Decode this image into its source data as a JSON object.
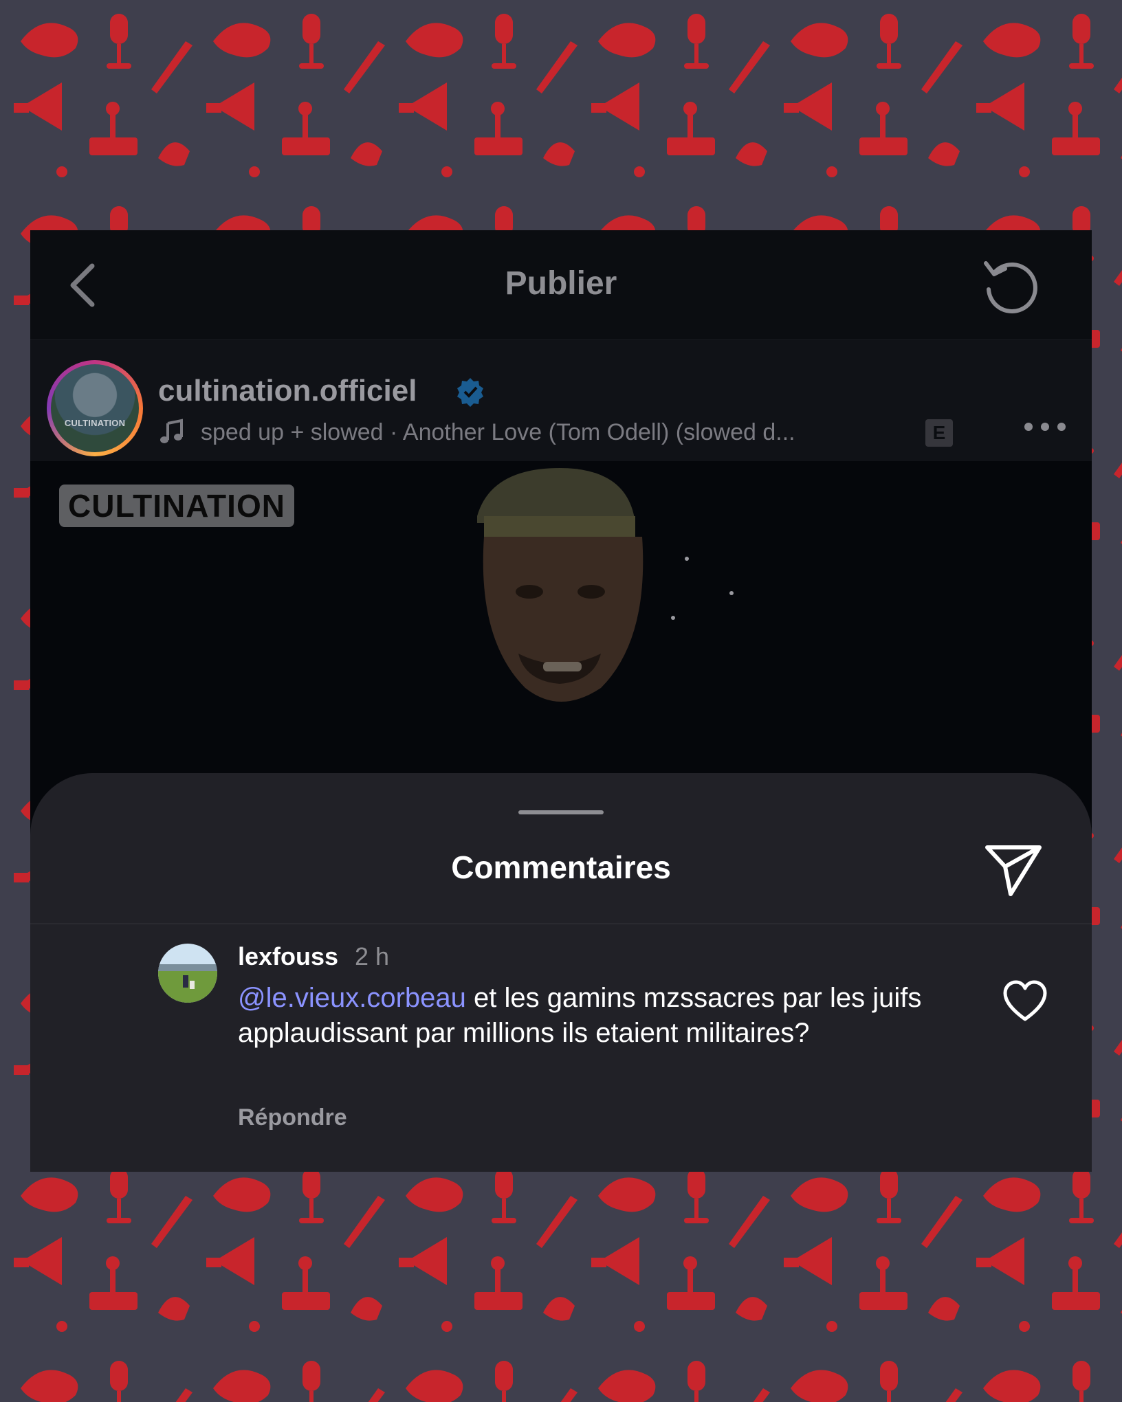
{
  "header": {
    "title": "Publier"
  },
  "post": {
    "username": "cultination.officiel",
    "avatar_label": "CULTINATION",
    "music": "sped up + slowed · Another Love (Tom Odell) (slowed d...",
    "explicit_badge": "E",
    "video_tag": "CULTINATION"
  },
  "comments_sheet": {
    "title": "Commentaires",
    "comment": {
      "username": "lexfouss",
      "time": "2 h",
      "mention": "@le.vieux.corbeau",
      "text": " et les gamins mzssacres par les juifs applaudissant par millions ils etaient militaires?",
      "reply_label": "Répondre"
    }
  },
  "icons": {
    "back": "chevron-left-icon",
    "refresh": "refresh-icon",
    "verified": "verified-badge-icon",
    "music": "music-note-icon",
    "more": "more-dots-icon",
    "share": "paper-plane-icon",
    "like": "heart-icon"
  },
  "colors": {
    "background": "#3f3f4d",
    "pattern": "#c8252c",
    "card": "#0a0c10",
    "sheet": "#212127",
    "mention": "#8b93ff",
    "verified": "#1d9bf0"
  }
}
